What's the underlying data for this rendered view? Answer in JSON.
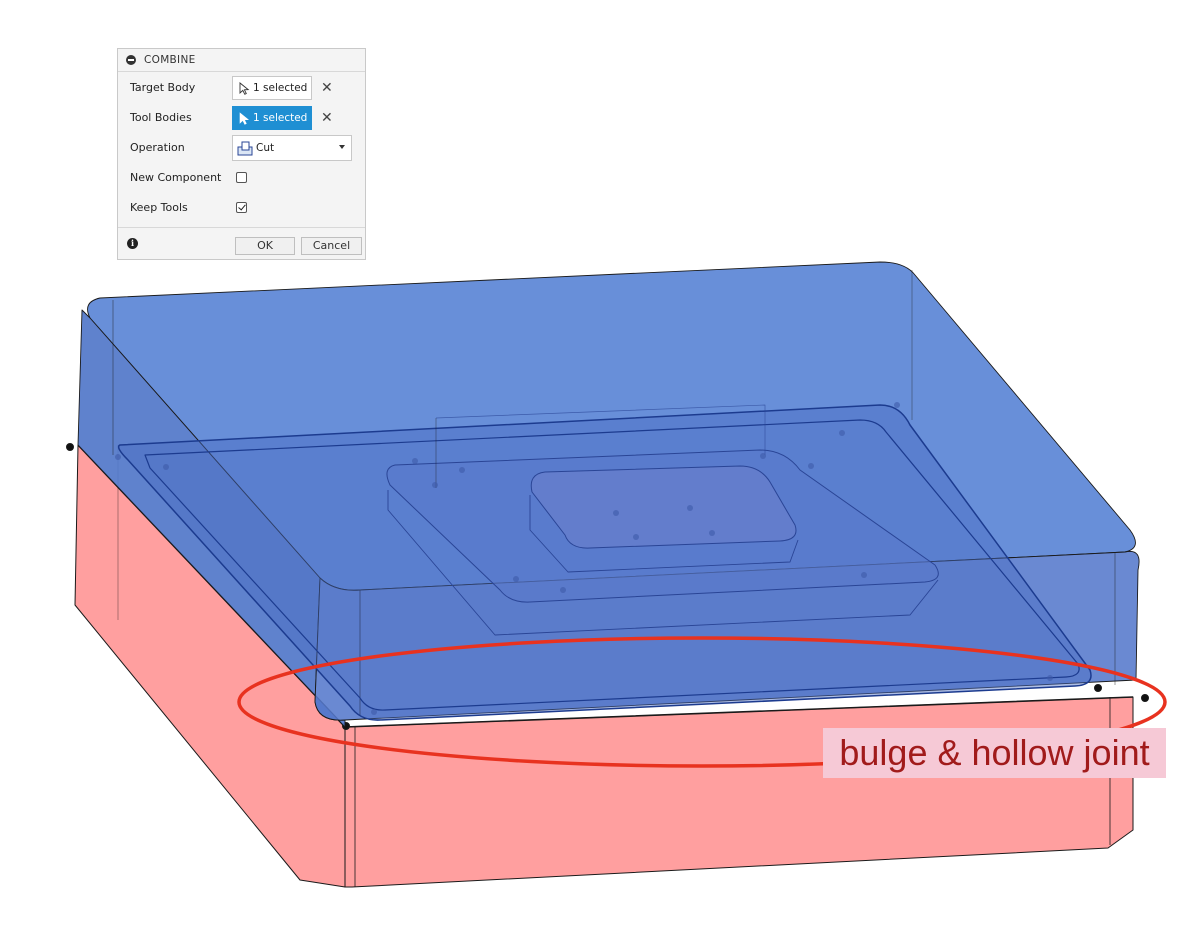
{
  "panel": {
    "title": "COMBINE",
    "target_body": {
      "label": "Target Body",
      "value": "1 selected"
    },
    "tool_bodies": {
      "label": "Tool Bodies",
      "value": "1 selected"
    },
    "operation": {
      "label": "Operation",
      "value": "Cut"
    },
    "new_component": {
      "label": "New Component",
      "checked": false
    },
    "keep_tools": {
      "label": "Keep Tools",
      "checked": true
    },
    "ok_label": "OK",
    "cancel_label": "Cancel",
    "clear_symbol": "✕",
    "info_symbol": "i"
  },
  "annotation": {
    "text": "bulge & hollow joint",
    "text_color": "#a11b1b",
    "background": "#f6c9d6",
    "ellipse_color": "#e8321f"
  },
  "bodies": {
    "target_color": "#ff9a9a",
    "tool_color": "#5b86d6"
  },
  "colors": {
    "accent": "#1f8fd3"
  }
}
